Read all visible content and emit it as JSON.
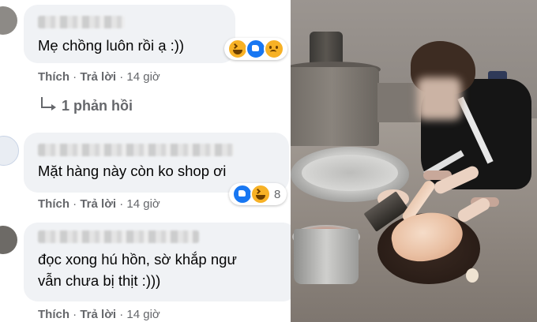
{
  "comments": [
    {
      "text": "Mẹ chồng luôn rồi ạ :))",
      "actions": {
        "like": "Thích",
        "reply": "Trả lời",
        "time": "14 giờ"
      },
      "reactions": [
        "haha",
        "like",
        "sad"
      ],
      "reaction_count": ""
    },
    {
      "text": "Mặt hàng này còn ko shop ơi",
      "actions": {
        "like": "Thích",
        "reply": "Trả lời",
        "time": "14 giờ"
      },
      "reactions": [
        "like",
        "haha"
      ],
      "reaction_count": "8"
    },
    {
      "text_line1": "đọc xong hú hồn, sờ khắp ngư",
      "text_line2": "vẫn chưa bị thịt :)))",
      "actions": {
        "like": "Thích",
        "reply": "Trả lời",
        "time": "14 giờ"
      }
    }
  ],
  "replies_link": "1 phản hồi",
  "colors": {
    "bubble": "#f0f2f5",
    "meta": "#65676b",
    "like_blue": "#1877f2",
    "haha_yellow": "#f7b125"
  }
}
